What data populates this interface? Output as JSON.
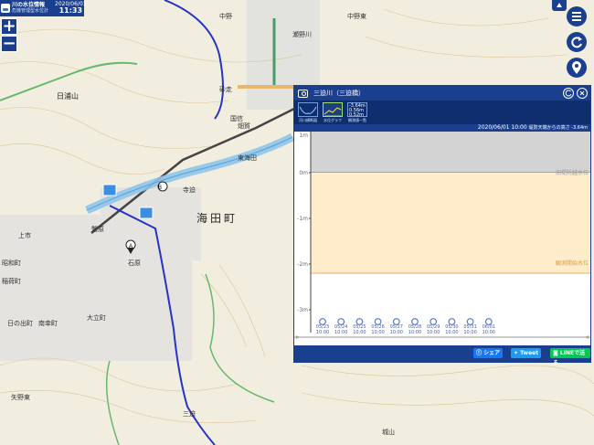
{
  "app": {
    "title": "川の水位情報",
    "subtitle": "危機管理型水位計",
    "date": "2020/06/01",
    "time": "11:33"
  },
  "zoom": {
    "in": "+",
    "out": "−"
  },
  "fab_icons": [
    "menu-icon",
    "refresh-icon",
    "location-pin-icon"
  ],
  "map_labels": {
    "town": "海田町",
    "mountain": "日浦山",
    "marker_a": "A",
    "marker_b": "B",
    "minor": [
      "中野",
      "中野東",
      "瀬野川",
      "砂走",
      "畑賀",
      "蟹原",
      "上市",
      "稲荷町",
      "大立町",
      "南幸町",
      "日の出町",
      "矢野東",
      "三迫",
      "城山",
      "国信",
      "昭和町",
      "石原",
      "寺迫",
      "東海田"
    ]
  },
  "panel": {
    "title": "三迫川（三迫橋）",
    "tools": [
      {
        "label": "河川横断図"
      },
      {
        "label": "水位グラフ"
      },
      {
        "label": "観測値一覧",
        "vals": [
          "-3.64m",
          "0.56m",
          "0.52m"
        ]
      }
    ],
    "datetime": "2020/06/01 10:00",
    "level_note": "堤防天端からの高さ -3.64m",
    "chart_labels": {
      "top": "旧堤防越水位",
      "mid": "観測開始水位"
    },
    "buttons": {
      "share": "シェア",
      "tweet": "Tweet",
      "line": "LINEで送る"
    }
  },
  "chart_data": {
    "type": "line",
    "ylabel": "",
    "ylim": [
      -3.4,
      0.9
    ],
    "yticks": [
      "1m",
      "0m",
      "-1m",
      "-2m",
      "-3m"
    ],
    "bands": [
      {
        "label": "旧堤防越水位",
        "from": 0,
        "to": 0.9,
        "color": "#d3d3d3"
      },
      {
        "label": "観測開始水位",
        "from": -2.2,
        "to": 0,
        "color": "#ffeccb"
      }
    ],
    "categories": [
      "05/23\n10:00",
      "05/24\n10:00",
      "05/25\n10:00",
      "05/26\n10:00",
      "05/27\n10:00",
      "05/28\n10:00",
      "05/29\n10:00",
      "05/30\n10:00",
      "05/31\n10:00",
      "06/01\n10:00"
    ],
    "colors": {
      "accent": "#1b3f8f",
      "water": "#5a78d6"
    }
  }
}
